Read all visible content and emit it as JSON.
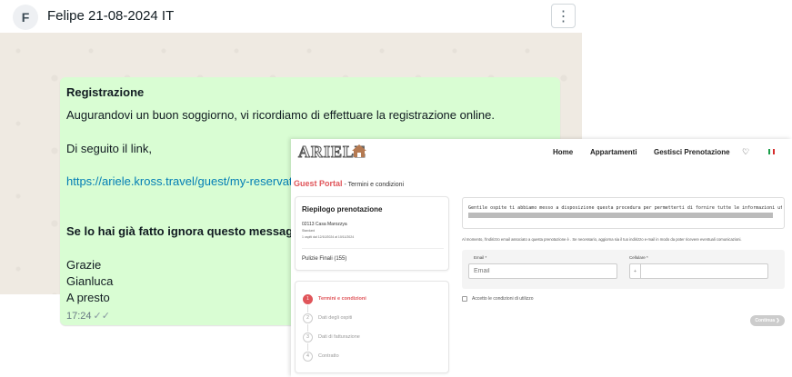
{
  "chat": {
    "avatar_letter": "F",
    "title": "Felipe   21-08-2024 IT",
    "menu_icon": "⋮",
    "message": {
      "heading": "Registrazione",
      "line1": "Augurandovi un buon soggiorno, vi ricordiamo di effettuare la registrazione online.",
      "line2": "Di seguito il link,",
      "link": "https://ariele.kross.travel/guest/my-reservati",
      "line3": "Se lo hai già fatto ignora questo messaggio",
      "sign1": "Grazie",
      "sign2": "Gianluca",
      "sign3": "A presto",
      "time": "17:24"
    }
  },
  "portal": {
    "logo": "ARIELE",
    "nav": [
      "Home",
      "Appartamenti",
      "Gestisci Prenotazione"
    ],
    "heart_icon": "♡",
    "flag_colors": [
      "#1a9e4a",
      "#ffffff",
      "#d62d2d"
    ],
    "title_brand": "Guest Portal",
    "title_sub": " - Termini e condizioni",
    "recap": {
      "title": "Riepilogo prenotazione",
      "code": "02113 Casa Marozzya",
      "rate": "Standard",
      "dates": "1 ospiti dal 12/10/2024 al 10/11/2024",
      "fee": "Pulizie Finali (155)"
    },
    "steps": [
      {
        "num": "1",
        "label": "Termini e condizioni"
      },
      {
        "num": "2",
        "label": "Dati degli ospiti"
      },
      {
        "num": "3",
        "label": "Dati di fatturazione"
      },
      {
        "num": "4",
        "label": "Contratto"
      }
    ],
    "terms_text": "Gentile ospite ti abbiamo messo a disposizione questa procedura per permetterti di fornire tutte le informazioni ut",
    "info_note": "Al momento, l'indirizzo email associato a questa prenotazione è . Se necessario, aggiorna sia il tuo indirizzo e-mail in modo da poter ricevere eventuali comunicazioni.",
    "email_label": "Email *",
    "email_placeholder": "Email",
    "phone_label": "Cellulare *",
    "phone_prefix": "+",
    "accept_label": "Accetto le condizioni di utilizzo",
    "continue_label": "Continua ❯"
  }
}
